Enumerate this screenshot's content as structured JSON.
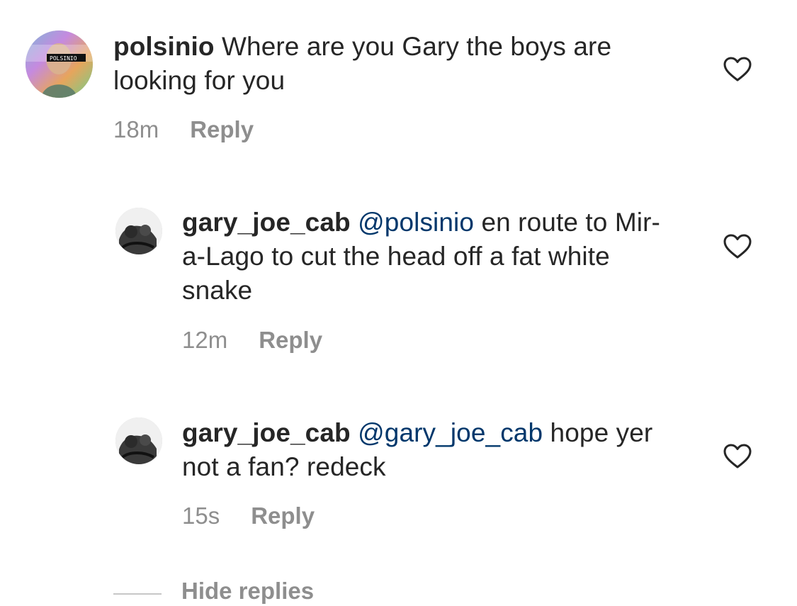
{
  "comments": [
    {
      "username": "polsinio",
      "text": " Where are you Gary the boys are looking for you",
      "time": "18m",
      "reply_label": "Reply",
      "avatar_label": "POLSINIO"
    },
    {
      "username": "gary_joe_cab",
      "mention": "@polsinio",
      "text": " en route to Mir-a-Lago to cut the head off a fat white snake",
      "time": "12m",
      "reply_label": "Reply"
    },
    {
      "username": "gary_joe_cab",
      "mention": "@gary_joe_cab",
      "text": " hope yer not a fan? redeck",
      "time": "15s",
      "reply_label": "Reply"
    }
  ],
  "hide_replies_label": "Hide replies",
  "icons": {
    "like": "heart-outline-icon"
  },
  "colors": {
    "text": "#262626",
    "secondary": "#8e8e8e",
    "mention": "#00376b"
  }
}
